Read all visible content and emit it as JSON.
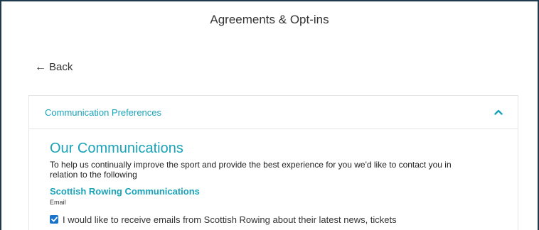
{
  "page": {
    "title": "Agreements & Opt-ins"
  },
  "back": {
    "arrow": "←",
    "label": "Back"
  },
  "panel": {
    "header_label": "Communication Preferences",
    "header_icon": "chevron-up-icon",
    "section_title": "Our Communications",
    "intro": "To help us continually improve the sport and provide the best experience for you we'd like to contact you in relation to the following",
    "subsection_title": "Scottish Rowing Communications",
    "field_label": "Email",
    "checkbox": {
      "checked": true,
      "label": "I would like to receive emails from Scottish Rowing about their latest news, tickets"
    }
  },
  "colors": {
    "accent": "#1aa3b8",
    "checkbox": "#1a73c8",
    "frame_border": "#1f3a4d"
  }
}
